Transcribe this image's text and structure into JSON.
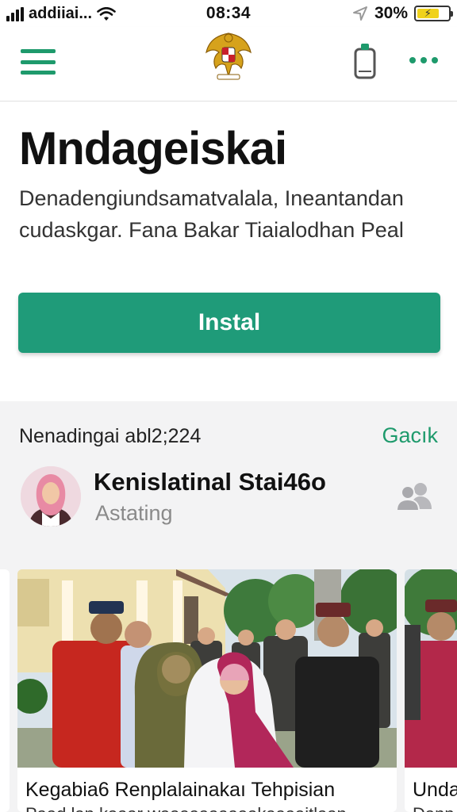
{
  "status_bar": {
    "carrier": "addiiai...",
    "time": "08:34",
    "battery_percent": "30%"
  },
  "nav": {
    "menu_icon": "hamburger-icon",
    "logo": "garuda-emblem",
    "device_icon": "phone-device-icon",
    "more_icon": "more-dots-icon"
  },
  "hero": {
    "title": "Mndageiskai",
    "description_line1": "Denadengiundsamatvalala, Ineantandan",
    "description_line2": "cudaskgar. Fana Bakar Tiaialodhan Peal",
    "install_label": "Instal"
  },
  "feed": {
    "header_label": "Nenadingai abl2;224",
    "header_action": "Gacık",
    "author": {
      "name": "Kenislatinal Stai46o",
      "subtitle": "Astating"
    },
    "cards": [
      {
        "title": "Kegabia6 Renplalainakaı Tehpisian",
        "subtitle": "Paad lan kaaar waaaaaaaaaakaaaaitlaan"
      },
      {
        "title": "Unda",
        "subtitle": "Dann"
      }
    ]
  },
  "colors": {
    "accent": "#1e9a6c",
    "install_button": "#1f9b79",
    "feed_background": "#f3f3f4",
    "battery_fill": "#f0d21c"
  }
}
